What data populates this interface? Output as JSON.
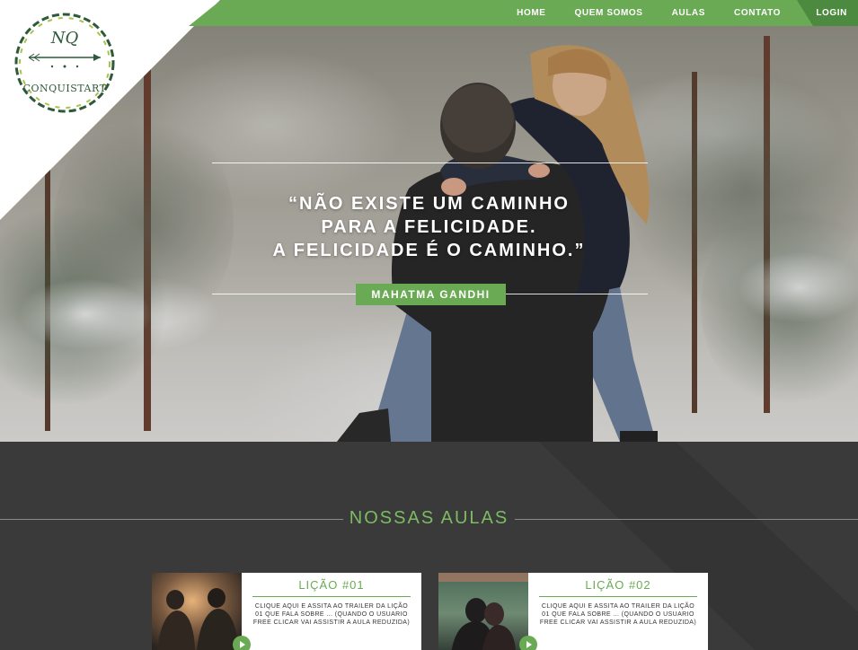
{
  "brand": {
    "monogram": "NQ",
    "name": "CONQUISTART"
  },
  "nav": {
    "items": [
      "HOME",
      "QUEM SOMOS",
      "AULAS",
      "CONTATO"
    ],
    "login": "LOGIN"
  },
  "hero": {
    "quote_lines": [
      "“NÃO EXISTE UM CAMINHO",
      "PARA A FELICIDADE.",
      "A FELICIDADE É O CAMINHO.”"
    ],
    "author": "MAHATMA GANDHI"
  },
  "section": {
    "title": "NOSSAS AULAS"
  },
  "lessons": [
    {
      "title": "LIÇÃO #01",
      "description": "CLIQUE AQUI E ASSITA AO TRAILER DA LIÇÃO 01 QUE FALA SOBRE ... (QUANDO O USUARIO FREE CLICAR VAI ASSISTIR A AULA REDUZIDA)"
    },
    {
      "title": "LIÇÃO #02",
      "description": "CLIQUE AQUI E ASSITA AO TRAILER DA LIÇÃO 01 QUE FALA SOBRE ... (QUANDO O USUARIO FREE CLICAR VAI ASSISTIR A AULA REDUZIDA)"
    }
  ],
  "colors": {
    "accent": "#6aaa54",
    "accent_dark": "#4c8a3f",
    "section_bg": "#3a3a3a"
  }
}
